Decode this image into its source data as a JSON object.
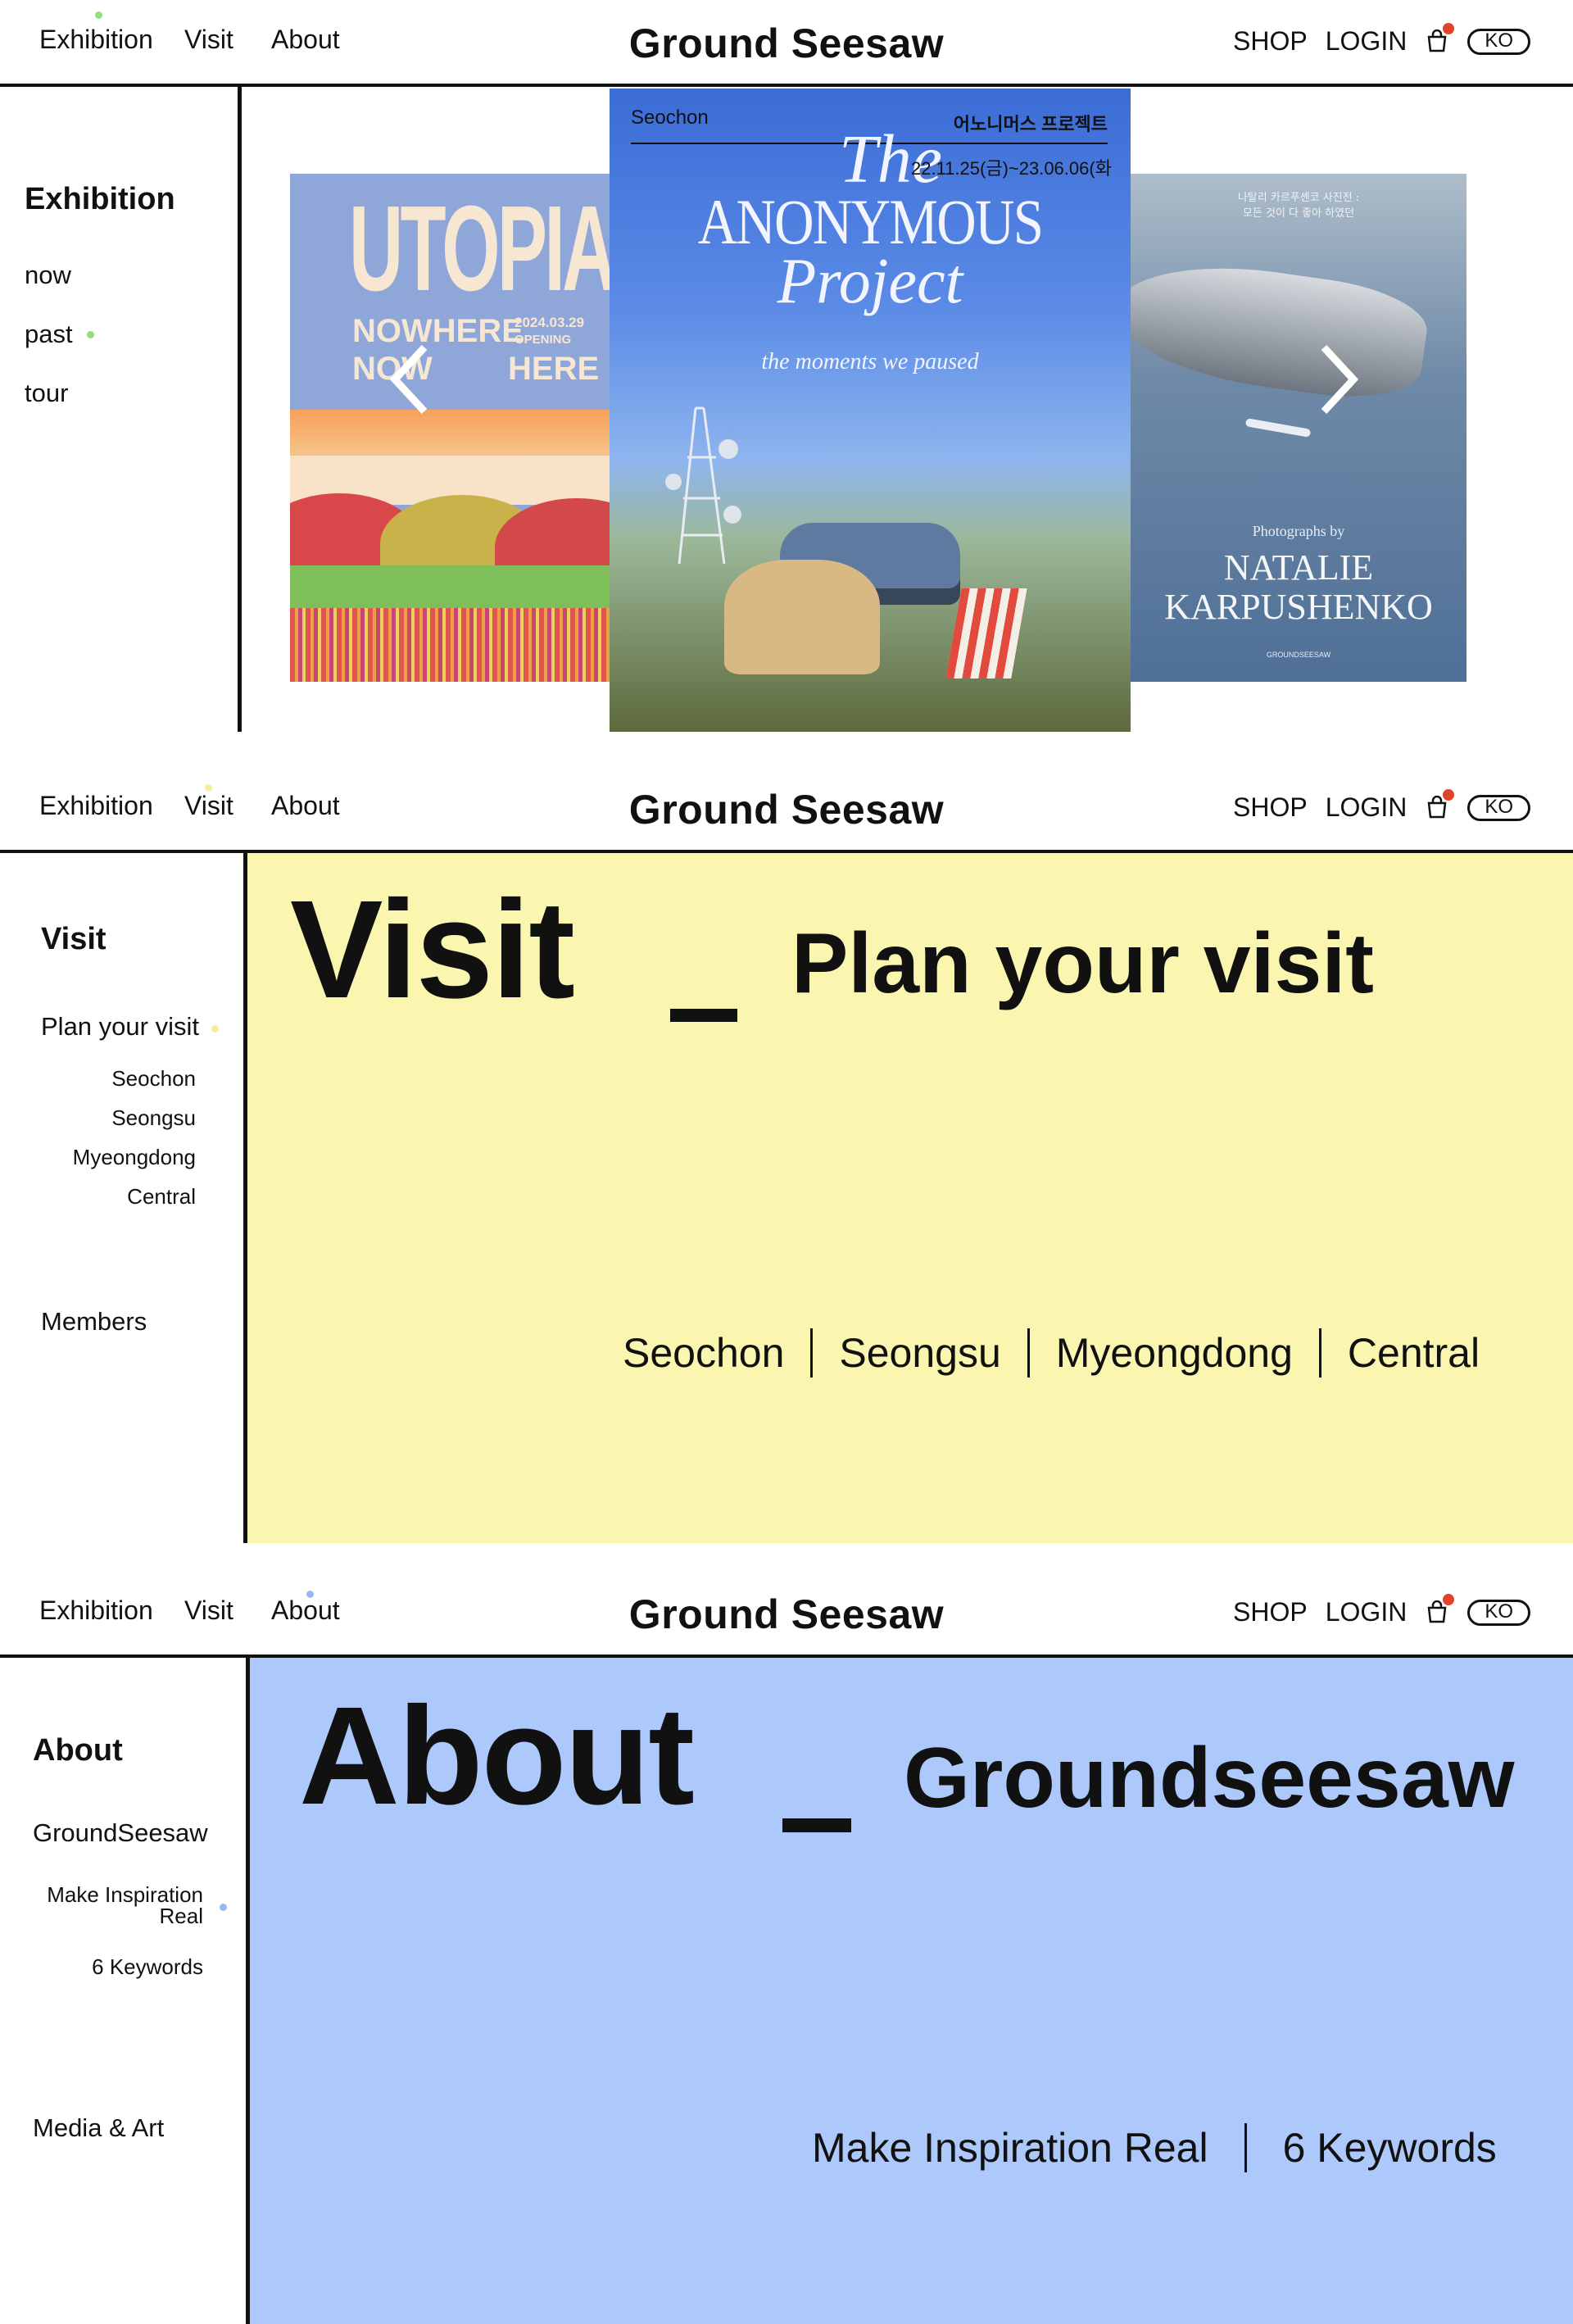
{
  "brand": "Ground Seesaw",
  "nav": {
    "exhibition": "Exhibition",
    "visit": "Visit",
    "about": "About"
  },
  "header_right": {
    "shop": "SHOP",
    "login": "LOGIN",
    "lang": "KO"
  },
  "exhibition_panel": {
    "side_heading": "Exhibition",
    "side_items": [
      "now",
      "past",
      "tour"
    ],
    "posters": {
      "left": {
        "title": "UTOPIA",
        "line1": "NOWHERE",
        "date": "2024.03.29",
        "opening": "OPENING",
        "line2a": "NOW",
        "line2b": "HERE"
      },
      "center": {
        "venue": "Seochon",
        "korean": "어노니머스 프로젝트",
        "the": "The",
        "dates": "22.11.25(금)~23.06.06(화",
        "title1": "ANONYMOUS",
        "title2": "Project",
        "tagline": "the moments we paused"
      },
      "right": {
        "korean": "나탈리 카르푸셴코 사진전 :\n모든 것이 다 좋아 하였던",
        "by": "Photographs by",
        "name1": "NATALIE",
        "name2": "KARPUSHENKO",
        "brand_small": "GROUNDSEESAW"
      }
    }
  },
  "visit_panel": {
    "side_heading": "Visit",
    "side_plan": "Plan your visit",
    "side_locs": [
      "Seochon",
      "Seongsu",
      "Myeongdong",
      "Central"
    ],
    "side_members": "Members",
    "title": "Visit",
    "underscore": "_",
    "subtitle": "Plan your visit",
    "locations": [
      "Seochon",
      "Seongsu",
      "Myeongdong",
      "Central"
    ],
    "bg": "#faf6b0"
  },
  "about_panel": {
    "side_heading": "About",
    "side_main": "GroundSeesaw",
    "side_sub1": "Make Inspiration Real",
    "side_sub2": "6 Keywords",
    "side_media": "Media & Art",
    "title": "About",
    "underscore": "_",
    "subtitle": "Groundseesaw",
    "links": [
      "Make Inspiration Real",
      "6 Keywords"
    ],
    "bg": "#adc8fa"
  },
  "colors": {
    "green_dot": "#8fe07a",
    "yellow_dot": "#f4ee99",
    "blue_dot": "#9ab6f5",
    "badge": "#e0452b"
  }
}
